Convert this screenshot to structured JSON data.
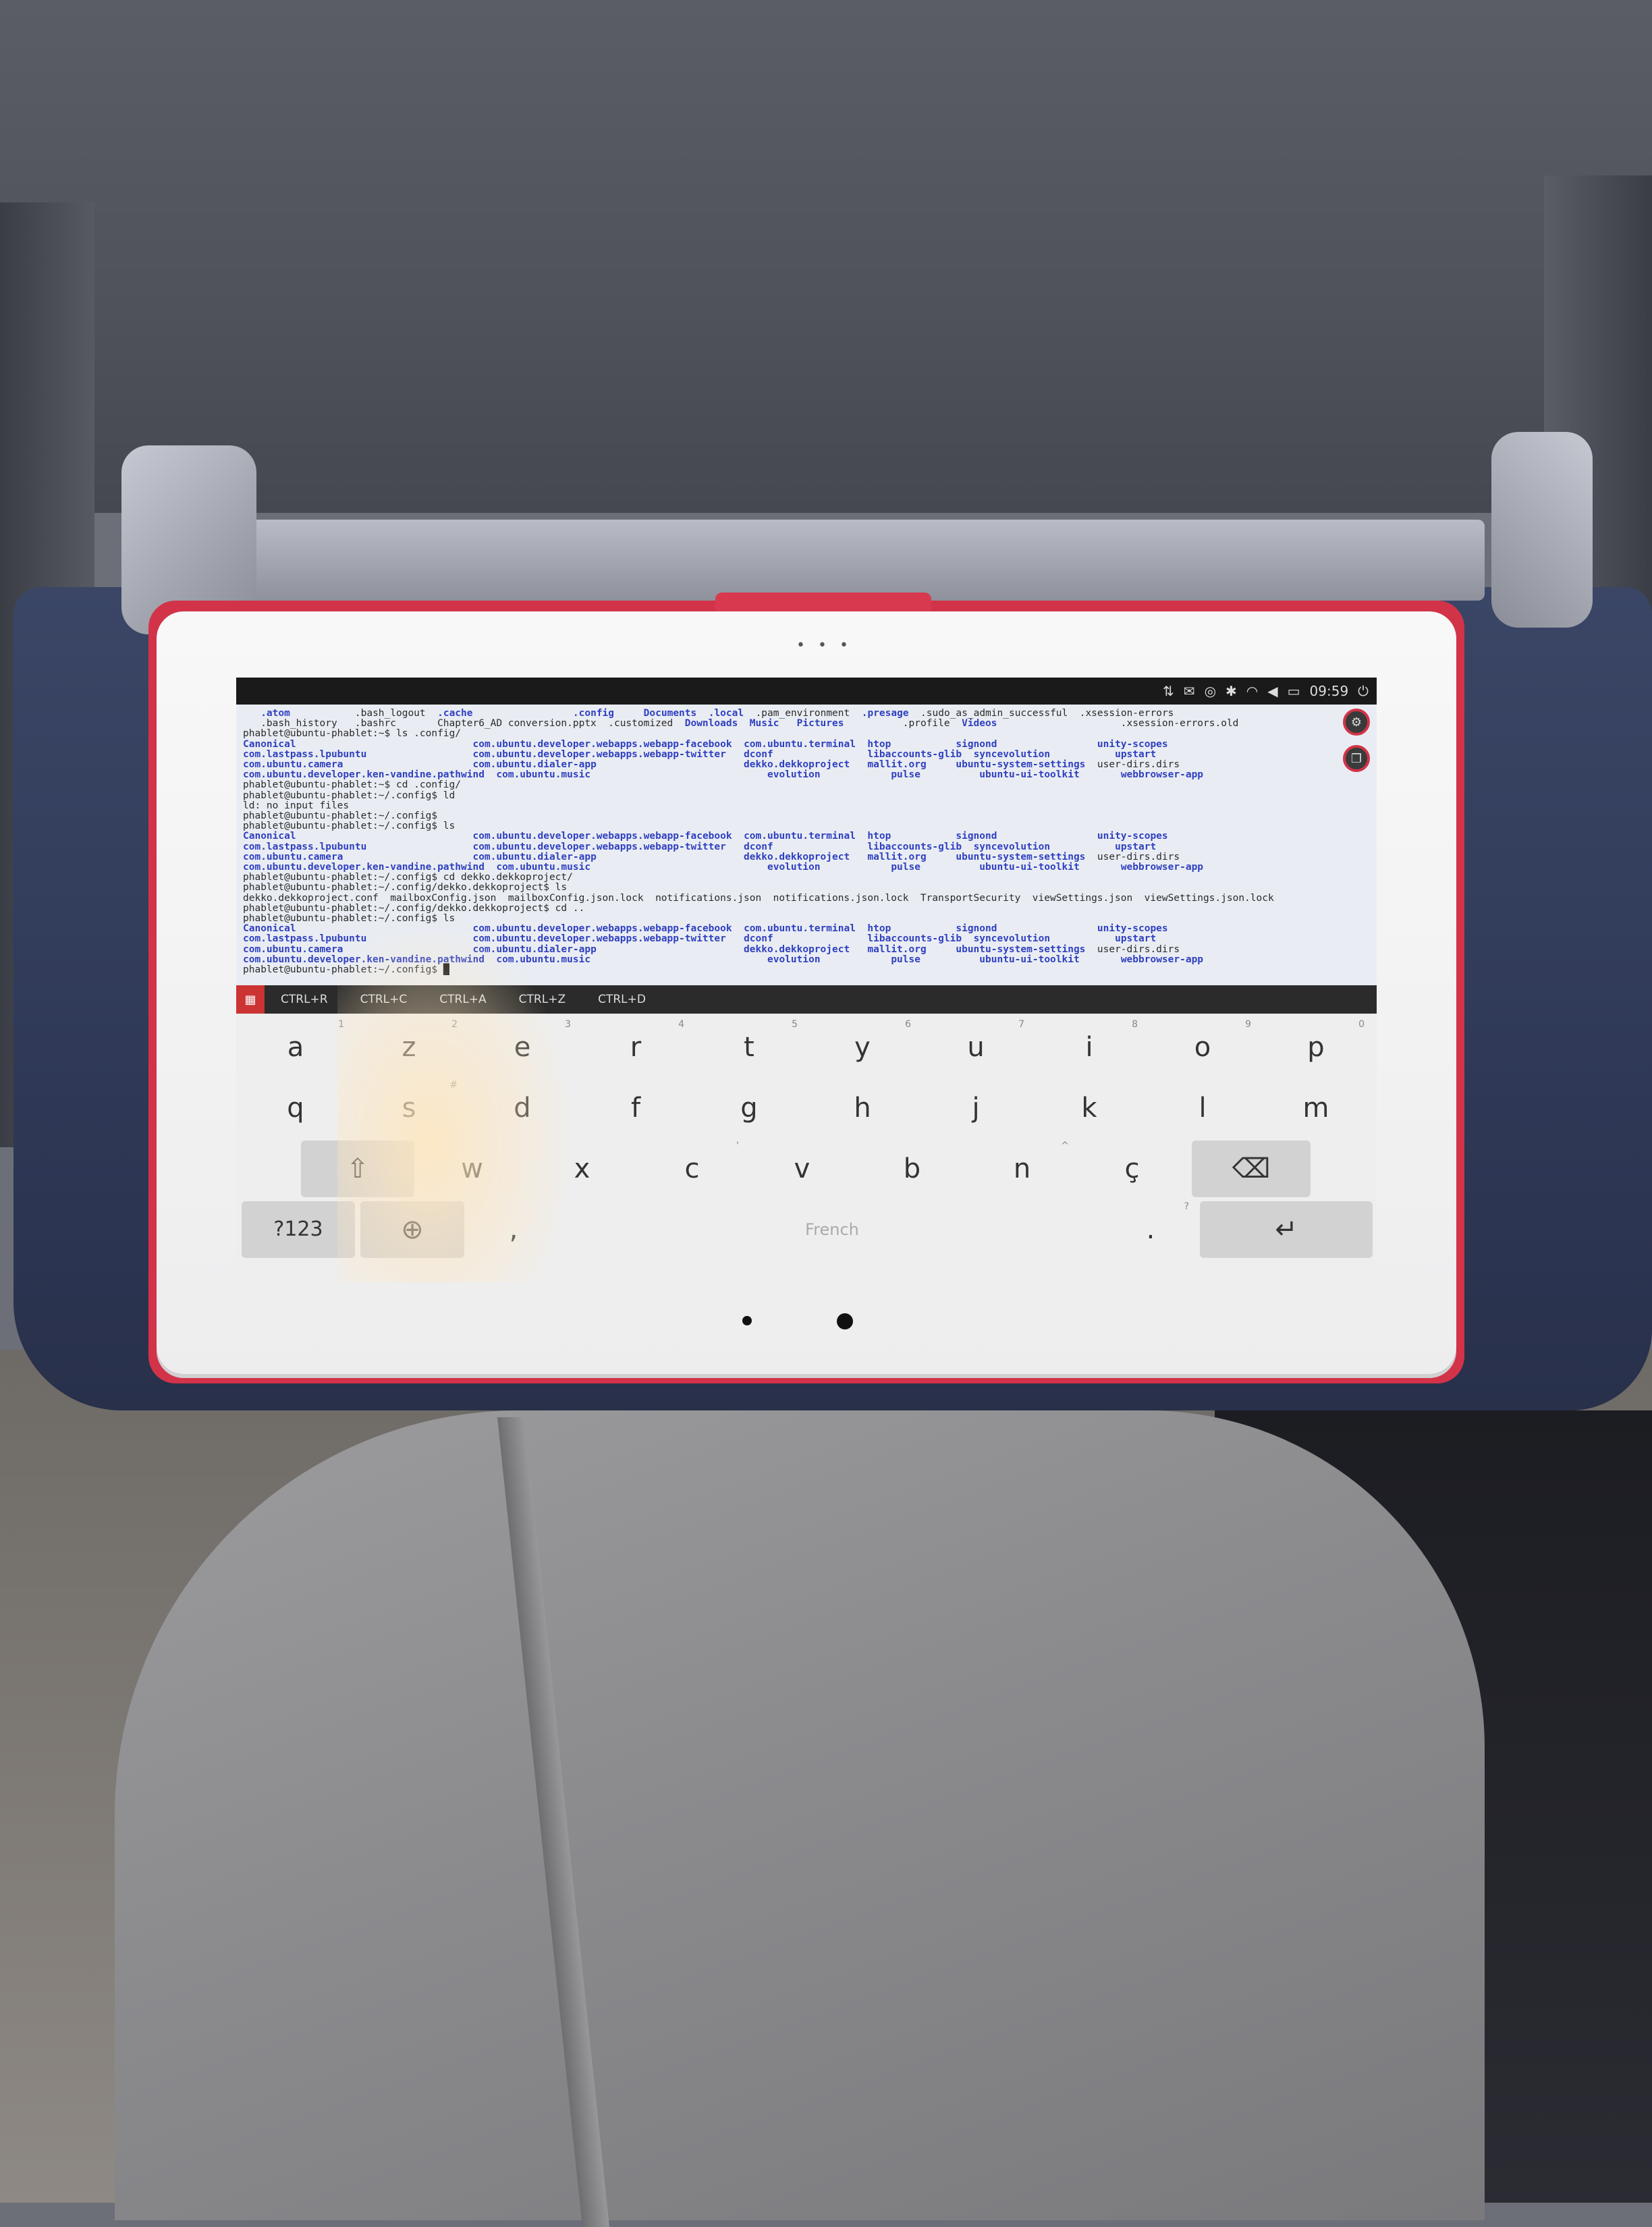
{
  "status_bar": {
    "time": "09:59",
    "icons": [
      "network-icon",
      "mail-icon",
      "location-icon",
      "bluetooth-icon",
      "wifi-icon",
      "volume-icon",
      "battery-icon",
      "power-icon"
    ]
  },
  "terminal": {
    "lines": [
      [
        {
          "t": "   "
        },
        {
          "t": ".atom",
          "c": "dir"
        },
        {
          "t": "           .bash_logout  "
        },
        {
          "t": ".cache",
          "c": "dir"
        },
        {
          "t": "                 "
        },
        {
          "t": ".config",
          "c": "dir"
        },
        {
          "t": "     "
        },
        {
          "t": "Documents",
          "c": "dir"
        },
        {
          "t": "  "
        },
        {
          "t": ".local",
          "c": "dir"
        },
        {
          "t": "  .pam_environment  "
        },
        {
          "t": ".presage",
          "c": "dir"
        },
        {
          "t": "  .sudo_as_admin_successful  .xsession-errors"
        }
      ],
      [
        {
          "t": "   .bash_history   .bashrc       Chapter6_AD conversion.pptx  .customized  "
        },
        {
          "t": "Downloads",
          "c": "dir"
        },
        {
          "t": "  "
        },
        {
          "t": "Music",
          "c": "dir"
        },
        {
          "t": "   "
        },
        {
          "t": "Pictures",
          "c": "dir"
        },
        {
          "t": "          .profile  "
        },
        {
          "t": "Videos",
          "c": "dir"
        },
        {
          "t": "                     .xsession-errors.old"
        }
      ],
      [
        {
          "t": "phablet@ubuntu-phablet:~$ ls .config/"
        }
      ],
      [
        {
          "t": "Canonical",
          "c": "dir"
        },
        {
          "t": "                              "
        },
        {
          "t": "com.ubuntu.developer.webapps.webapp-facebook",
          "c": "dir"
        },
        {
          "t": "  "
        },
        {
          "t": "com.ubuntu.terminal",
          "c": "dir"
        },
        {
          "t": "  "
        },
        {
          "t": "htop",
          "c": "dir"
        },
        {
          "t": "           "
        },
        {
          "t": "signond",
          "c": "dir"
        },
        {
          "t": "                 "
        },
        {
          "t": "unity-scopes",
          "c": "dir"
        }
      ],
      [
        {
          "t": "com.lastpass.lpubuntu",
          "c": "dir"
        },
        {
          "t": "                  "
        },
        {
          "t": "com.ubuntu.developer.webapps.webapp-twitter",
          "c": "dir"
        },
        {
          "t": "   "
        },
        {
          "t": "dconf",
          "c": "dir"
        },
        {
          "t": "                "
        },
        {
          "t": "libaccounts-glib",
          "c": "dir"
        },
        {
          "t": "  "
        },
        {
          "t": "syncevolution",
          "c": "dir"
        },
        {
          "t": "           "
        },
        {
          "t": "upstart",
          "c": "dir"
        }
      ],
      [
        {
          "t": "com.ubuntu.camera",
          "c": "dir"
        },
        {
          "t": "                      "
        },
        {
          "t": "com.ubuntu.dialer-app",
          "c": "dir"
        },
        {
          "t": "                         "
        },
        {
          "t": "dekko.dekkoproject",
          "c": "dir"
        },
        {
          "t": "   "
        },
        {
          "t": "mallit.org",
          "c": "dir"
        },
        {
          "t": "     "
        },
        {
          "t": "ubuntu-system-settings",
          "c": "dir"
        },
        {
          "t": "  user-dirs.dirs"
        }
      ],
      [
        {
          "t": "com.ubuntu.developer.ken-vandine.pathwind",
          "c": "dir"
        },
        {
          "t": "  "
        },
        {
          "t": "com.ubuntu.music",
          "c": "dir"
        },
        {
          "t": "                              "
        },
        {
          "t": "evolution",
          "c": "dir"
        },
        {
          "t": "            "
        },
        {
          "t": "pulse",
          "c": "dir"
        },
        {
          "t": "          "
        },
        {
          "t": "ubuntu-ui-toolkit",
          "c": "dir"
        },
        {
          "t": "       "
        },
        {
          "t": "webbrowser-app",
          "c": "dir"
        }
      ],
      [
        {
          "t": "phablet@ubuntu-phablet:~$ cd .config/"
        }
      ],
      [
        {
          "t": "phablet@ubuntu-phablet:~/.config$ ld"
        }
      ],
      [
        {
          "t": "ld: no input files"
        }
      ],
      [
        {
          "t": "phablet@ubuntu-phablet:~/.config$"
        }
      ],
      [
        {
          "t": "phablet@ubuntu-phablet:~/.config$ ls"
        }
      ],
      [
        {
          "t": "Canonical",
          "c": "dir"
        },
        {
          "t": "                              "
        },
        {
          "t": "com.ubuntu.developer.webapps.webapp-facebook",
          "c": "dir"
        },
        {
          "t": "  "
        },
        {
          "t": "com.ubuntu.terminal",
          "c": "dir"
        },
        {
          "t": "  "
        },
        {
          "t": "htop",
          "c": "dir"
        },
        {
          "t": "           "
        },
        {
          "t": "signond",
          "c": "dir"
        },
        {
          "t": "                 "
        },
        {
          "t": "unity-scopes",
          "c": "dir"
        }
      ],
      [
        {
          "t": "com.lastpass.lpubuntu",
          "c": "dir"
        },
        {
          "t": "                  "
        },
        {
          "t": "com.ubuntu.developer.webapps.webapp-twitter",
          "c": "dir"
        },
        {
          "t": "   "
        },
        {
          "t": "dconf",
          "c": "dir"
        },
        {
          "t": "                "
        },
        {
          "t": "libaccounts-glib",
          "c": "dir"
        },
        {
          "t": "  "
        },
        {
          "t": "syncevolution",
          "c": "dir"
        },
        {
          "t": "           "
        },
        {
          "t": "upstart",
          "c": "dir"
        }
      ],
      [
        {
          "t": "com.ubuntu.camera",
          "c": "dir"
        },
        {
          "t": "                      "
        },
        {
          "t": "com.ubuntu.dialer-app",
          "c": "dir"
        },
        {
          "t": "                         "
        },
        {
          "t": "dekko.dekkoproject",
          "c": "dir"
        },
        {
          "t": "   "
        },
        {
          "t": "mallit.org",
          "c": "dir"
        },
        {
          "t": "     "
        },
        {
          "t": "ubuntu-system-settings",
          "c": "dir"
        },
        {
          "t": "  user-dirs.dirs"
        }
      ],
      [
        {
          "t": "com.ubuntu.developer.ken-vandine.pathwind",
          "c": "dir"
        },
        {
          "t": "  "
        },
        {
          "t": "com.ubuntu.music",
          "c": "dir"
        },
        {
          "t": "                              "
        },
        {
          "t": "evolution",
          "c": "dir"
        },
        {
          "t": "            "
        },
        {
          "t": "pulse",
          "c": "dir"
        },
        {
          "t": "          "
        },
        {
          "t": "ubuntu-ui-toolkit",
          "c": "dir"
        },
        {
          "t": "       "
        },
        {
          "t": "webbrowser-app",
          "c": "dir"
        }
      ],
      [
        {
          "t": "phablet@ubuntu-phablet:~/.config$ cd dekko.dekkoproject/"
        }
      ],
      [
        {
          "t": "phablet@ubuntu-phablet:~/.config/dekko.dekkoproject$ ls"
        }
      ],
      [
        {
          "t": "dekko.dekkoproject.conf  mailboxConfig.json  mailboxConfig.json.lock  notifications.json  notifications.json.lock  TransportSecurity  viewSettings.json  viewSettings.json.lock"
        }
      ],
      [
        {
          "t": "phablet@ubuntu-phablet:~/.config/dekko.dekkoproject$ cd .."
        }
      ],
      [
        {
          "t": "phablet@ubuntu-phablet:~/.config$ ls"
        }
      ],
      [
        {
          "t": "Canonical",
          "c": "dir"
        },
        {
          "t": "                              "
        },
        {
          "t": "com.ubuntu.developer.webapps.webapp-facebook",
          "c": "dir"
        },
        {
          "t": "  "
        },
        {
          "t": "com.ubuntu.terminal",
          "c": "dir"
        },
        {
          "t": "  "
        },
        {
          "t": "htop",
          "c": "dir"
        },
        {
          "t": "           "
        },
        {
          "t": "signond",
          "c": "dir"
        },
        {
          "t": "                 "
        },
        {
          "t": "unity-scopes",
          "c": "dir"
        }
      ],
      [
        {
          "t": "com.lastpass.lpubuntu",
          "c": "dir"
        },
        {
          "t": "                  "
        },
        {
          "t": "com.ubuntu.developer.webapps.webapp-twitter",
          "c": "dir"
        },
        {
          "t": "   "
        },
        {
          "t": "dconf",
          "c": "dir"
        },
        {
          "t": "                "
        },
        {
          "t": "libaccounts-glib",
          "c": "dir"
        },
        {
          "t": "  "
        },
        {
          "t": "syncevolution",
          "c": "dir"
        },
        {
          "t": "           "
        },
        {
          "t": "upstart",
          "c": "dir"
        }
      ],
      [
        {
          "t": "com.ubuntu.camera",
          "c": "dir"
        },
        {
          "t": "                      "
        },
        {
          "t": "com.ubuntu.dialer-app",
          "c": "dir"
        },
        {
          "t": "                         "
        },
        {
          "t": "dekko.dekkoproject",
          "c": "dir"
        },
        {
          "t": "   "
        },
        {
          "t": "mallit.org",
          "c": "dir"
        },
        {
          "t": "     "
        },
        {
          "t": "ubuntu-system-settings",
          "c": "dir"
        },
        {
          "t": "  user-dirs.dirs"
        }
      ],
      [
        {
          "t": "com.ubuntu.developer.ken-vandine.pathwind",
          "c": "dir"
        },
        {
          "t": "  "
        },
        {
          "t": "com.ubuntu.music",
          "c": "dir"
        },
        {
          "t": "                              "
        },
        {
          "t": "evolution",
          "c": "dir"
        },
        {
          "t": "            "
        },
        {
          "t": "pulse",
          "c": "dir"
        },
        {
          "t": "          "
        },
        {
          "t": "ubuntu-ui-toolkit",
          "c": "dir"
        },
        {
          "t": "       "
        },
        {
          "t": "webbrowser-app",
          "c": "dir"
        }
      ],
      [
        {
          "t": "phablet@ubuntu-phablet:~/.config$ "
        },
        {
          "t": "█",
          "c": "cursor"
        }
      ]
    ]
  },
  "ctrl_bar": {
    "keys": [
      "CTRL+R",
      "CTRL+C",
      "CTRL+A",
      "CTRL+Z",
      "CTRL+D"
    ]
  },
  "keyboard": {
    "row1": [
      {
        "label": "a",
        "hint": "1"
      },
      {
        "label": "z",
        "hint": "2"
      },
      {
        "label": "e",
        "hint": "3"
      },
      {
        "label": "r",
        "hint": "4"
      },
      {
        "label": "t",
        "hint": "5"
      },
      {
        "label": "y",
        "hint": "6"
      },
      {
        "label": "u",
        "hint": "7"
      },
      {
        "label": "i",
        "hint": "8"
      },
      {
        "label": "o",
        "hint": "9"
      },
      {
        "label": "p",
        "hint": "0"
      }
    ],
    "row2": [
      {
        "label": "q",
        "hint": ""
      },
      {
        "label": "s",
        "hint": "#"
      },
      {
        "label": "d",
        "hint": ""
      },
      {
        "label": "f",
        "hint": ""
      },
      {
        "label": "g",
        "hint": ""
      },
      {
        "label": "h",
        "hint": ""
      },
      {
        "label": "j",
        "hint": ""
      },
      {
        "label": "k",
        "hint": ""
      },
      {
        "label": "l",
        "hint": ""
      },
      {
        "label": "m",
        "hint": ""
      }
    ],
    "row3": [
      {
        "label": "w",
        "hint": ""
      },
      {
        "label": "x",
        "hint": ""
      },
      {
        "label": "c",
        "hint": "'"
      },
      {
        "label": "v",
        "hint": ""
      },
      {
        "label": "b",
        "hint": ""
      },
      {
        "label": "n",
        "hint": "^"
      },
      {
        "label": "ç",
        "hint": ""
      }
    ],
    "symbols_label": "?123",
    "comma_label": ",",
    "space_label": "French",
    "period_label": ".",
    "period_hint": "?"
  }
}
